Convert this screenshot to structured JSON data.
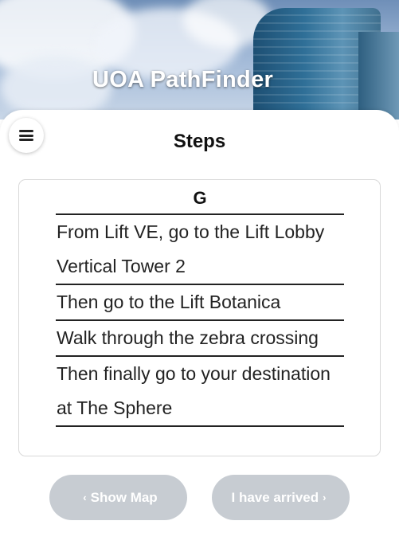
{
  "header": {
    "title": "UOA PathFinder"
  },
  "menu": {
    "icon": "menu-icon"
  },
  "steps_view": {
    "heading": "Steps",
    "group_label": "G",
    "steps": [
      "From Lift VE, go to the Lift Lobby Vertical Tower 2",
      "Then go to the Lift Botanica",
      "Walk through the zebra crossing",
      "Then finally go to your destination at The Sphere"
    ]
  },
  "footer": {
    "show_map_label": "Show Map",
    "arrived_label": "I have arrived",
    "left_chevron": "‹",
    "right_chevron": "›",
    "button_color": "#c7ccd2"
  }
}
